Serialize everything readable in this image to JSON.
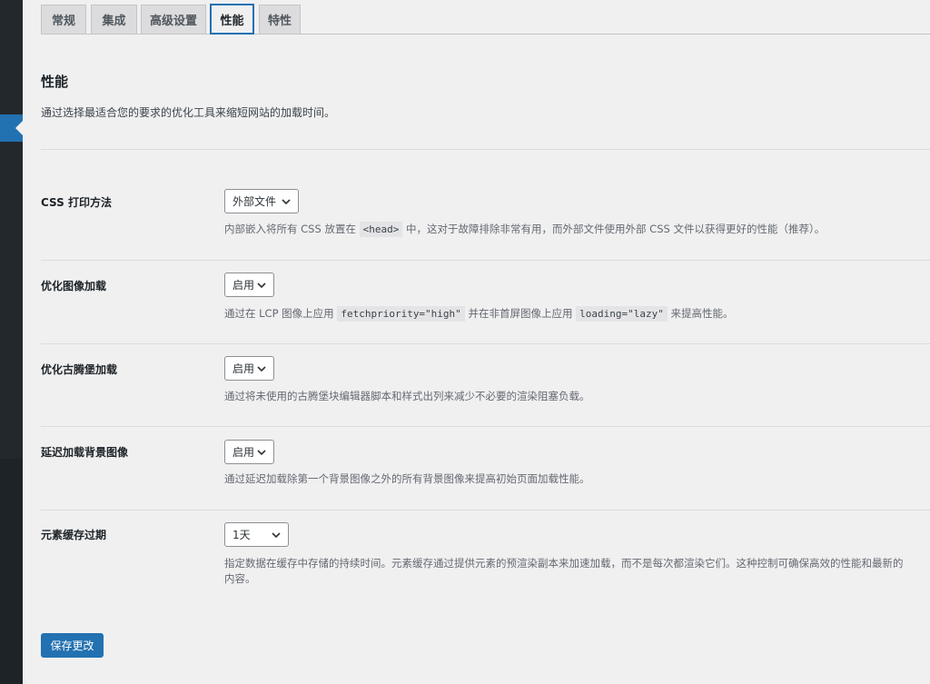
{
  "tabs": [
    {
      "label": "常规"
    },
    {
      "label": "集成"
    },
    {
      "label": "高级设置"
    },
    {
      "label": "性能"
    },
    {
      "label": "特性"
    }
  ],
  "active_tab": "性能",
  "section": {
    "title": "性能",
    "description": "通过选择最适合您的要求的优化工具来缩短网站的加载时间。"
  },
  "settings": [
    {
      "label": "CSS 打印方法",
      "value": "外部文件",
      "help_before": "内部嵌入将所有 CSS 放置在",
      "code1": "<head>",
      "help_after": "中，这对于故障排除非常有用，而外部文件使用外部 CSS 文件以获得更好的性能（推荐）。"
    },
    {
      "label": "优化图像加载",
      "value": "启用",
      "help_before": "通过在 LCP 图像上应用",
      "code1": "fetchpriority=\"high\"",
      "help_middle": "并在非首屏图像上应用",
      "code2": "loading=\"lazy\"",
      "help_after": "来提高性能。"
    },
    {
      "label": "优化古腾堡加载",
      "value": "启用",
      "help": "通过将未使用的古腾堡块编辑器脚本和样式出列来减少不必要的渲染阻塞负载。"
    },
    {
      "label": "延迟加载背景图像",
      "value": "启用",
      "help": "通过延迟加载除第一个背景图像之外的所有背景图像来提高初始页面加载性能。"
    },
    {
      "label": "元素缓存过期",
      "value": "1天",
      "help_line1": "指定数据在缓存中存储的持续时间。元素缓存通过提供元素的预渲染副本来加速加载，而不是每次都渲染它们。这种控制可确保高效的性能和最新的",
      "help_line2": "内容。"
    }
  ],
  "save_label": "保存更改",
  "icons": {
    "select_arrow": "chevron-down-icon"
  },
  "colors": {
    "primary": "#2271b1",
    "sidebar": "#1d2327"
  }
}
